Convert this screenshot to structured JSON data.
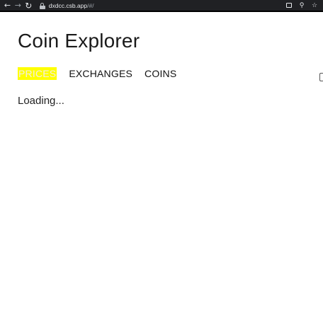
{
  "browser": {
    "url_host": "dxdcc.csb.app",
    "url_path": "/#/",
    "icons": {
      "back": "arrow-left-icon",
      "forward": "arrow-right-icon",
      "reload": "reload-icon",
      "lock": "lock-icon",
      "install": "install-app-icon",
      "zoom": "zoom-icon",
      "bookmark": "star-icon"
    }
  },
  "app": {
    "title": "Coin Explorer",
    "nav": [
      {
        "label": "PRICES",
        "active": true
      },
      {
        "label": "EXCHANGES",
        "active": false
      },
      {
        "label": "COINS",
        "active": false
      }
    ],
    "status": "Loading..."
  },
  "colors": {
    "active_nav_bg": "#ffff00",
    "browser_bar": "#202124"
  }
}
